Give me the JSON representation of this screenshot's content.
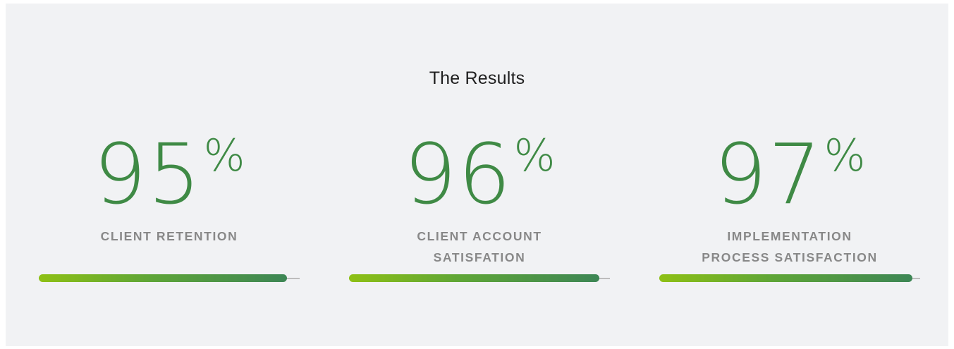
{
  "section": {
    "title": "The Results"
  },
  "stats": [
    {
      "number": "95",
      "unit": "%",
      "label_line1": "CLIENT RETENTION",
      "label_line2": "",
      "progress": 0.95
    },
    {
      "number": "96",
      "unit": "%",
      "label_line1": "CLIENT ACCOUNT",
      "label_line2": "SATISFATION",
      "progress": 0.96
    },
    {
      "number": "97",
      "unit": "%",
      "label_line1": "IMPLEMENTATION",
      "label_line2": "PROCESS SATISFACTION",
      "progress": 0.97
    }
  ],
  "colors": {
    "panel_background": "#f1f2f4",
    "number_green": "#3f8a45",
    "label_gray": "#888888",
    "bar_start": "#8ec015",
    "bar_end": "#3d8655",
    "track_gray": "#bdbdbd"
  }
}
